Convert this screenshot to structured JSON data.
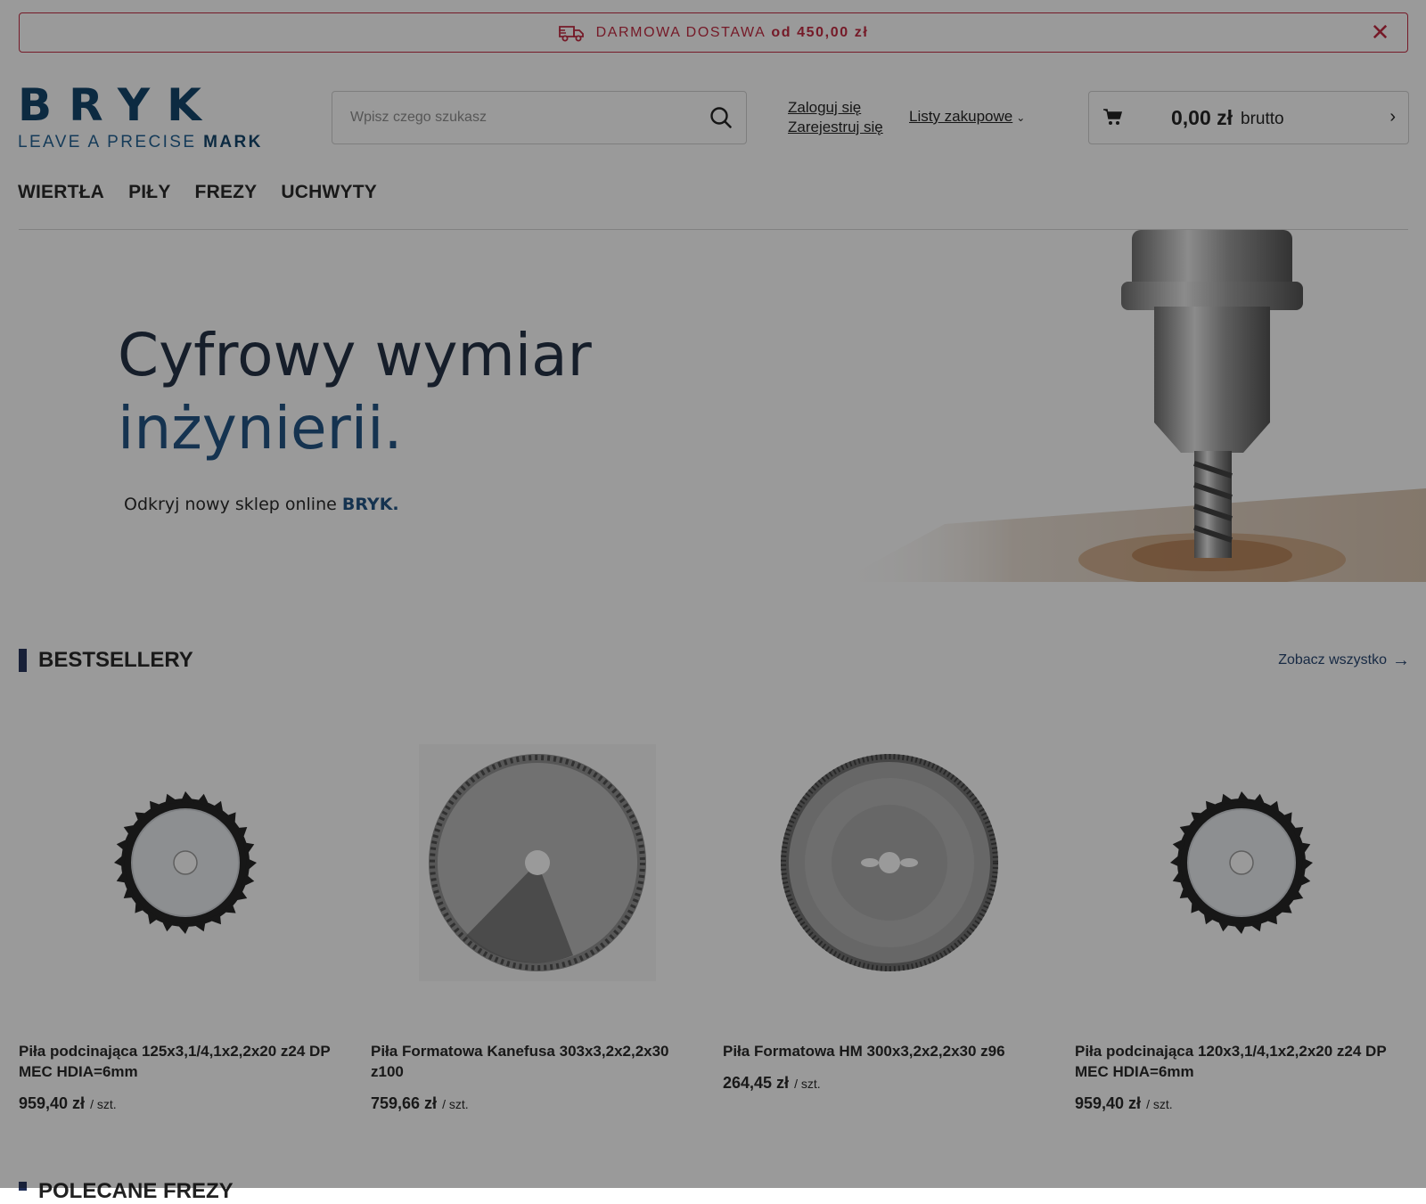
{
  "promo": {
    "text": "DARMOWA DOSTAWA",
    "amount": "od 450,00 zł",
    "close_glyph": "✕",
    "truck_icon": "delivery-truck-icon",
    "color": "#c0243b"
  },
  "header": {
    "logo_brand": "BRYK",
    "logo_tagline": "LEAVE A PRECISE",
    "logo_tagline_bold": "MARK",
    "search_placeholder": "Wpisz czego szukasz",
    "login": "Zaloguj się",
    "register": "Zarejestruj się",
    "lists": "Listy zakupowe",
    "cart_total": "0,00 zł",
    "cart_gross": "brutto",
    "cart_arrow": "›"
  },
  "nav": {
    "items": [
      "WIERTŁA",
      "PIŁY",
      "FREZY",
      "UCHWYTY"
    ]
  },
  "hero": {
    "line1": "Cyfrowy wymiar",
    "line2": "inżynierii.",
    "sub": "Odkryj nowy sklep online",
    "sub_bold": "BRYK."
  },
  "bestsellers": {
    "title": "BESTSELLERY",
    "see_all": "Zobacz wszystko",
    "products": [
      {
        "name": "Piła podcinająca 125x3,1/4,1x2,2x20 z24 DP MEC HDIA=6mm",
        "price": "959,40 zł",
        "unit": "/ szt."
      },
      {
        "name": "Piła Formatowa Kanefusa 303x3,2x2,2x30 z100",
        "price": "759,66 zł",
        "unit": "/ szt."
      },
      {
        "name": "Piła Formatowa HM 300x3,2x2,2x30 z96",
        "price": "264,45 zł",
        "unit": "/ szt."
      },
      {
        "name": "Piła podcinająca 120x3,1/4,1x2,2x20 z24 DP MEC HDIA=6mm",
        "price": "959,40 zł",
        "unit": "/ szt."
      }
    ]
  },
  "next_section": {
    "title": "POLECANE FREZY"
  },
  "colors": {
    "brand": "#0b3e66",
    "accent": "#1b4f80",
    "promo": "#c0243b"
  }
}
